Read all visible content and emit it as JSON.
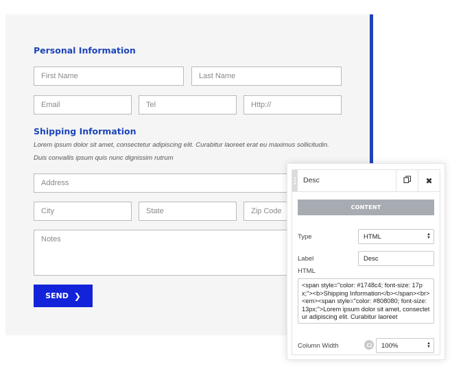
{
  "form": {
    "personal_title": "Personal Information",
    "first_name_placeholder": "First Name",
    "last_name_placeholder": "Last Name",
    "email_placeholder": "Email",
    "tel_placeholder": "Tel",
    "url_placeholder": "Http://",
    "shipping_title": "Shipping Information",
    "shipping_desc_line1": "Lorem ipsum dolor sit amet, consectetur adipiscing elit. Curabitur laoreet erat eu maximus sollicitudin.",
    "shipping_desc_line2": "Duis convallis ipsum quis nunc dignissim rutrum",
    "address_placeholder": "Address",
    "city_placeholder": "City",
    "state_placeholder": "State",
    "zip_placeholder": "Zip Code",
    "notes_placeholder": "Notes",
    "send_label": "SEND",
    "send_icon": "chevron-right-icon"
  },
  "panel": {
    "title": "Desc",
    "duplicate_icon": "duplicate-icon",
    "close_icon": "close-icon",
    "tab_label": "CONTENT",
    "type_label": "Type",
    "type_value": "HTML",
    "label_label": "Label",
    "label_value": "Desc",
    "html_label": "HTML",
    "html_value": "<span style=\"color: #1748c4; font-size: 17px;\"><b>Shipping Information</b></span><br><em><span style=\"color: #808080; font-size: 13px;\">Lorem ipsum dolor sit amet, consectetur adipiscing elit. Curabitur laoreet",
    "column_width_label": "Column Width",
    "column_width_value": "100%",
    "device_icon": "desktop-icon"
  },
  "colors": {
    "accent_blue": "#1d45b8",
    "send_button": "#1323d9",
    "tab_gray": "#a7acb2"
  }
}
